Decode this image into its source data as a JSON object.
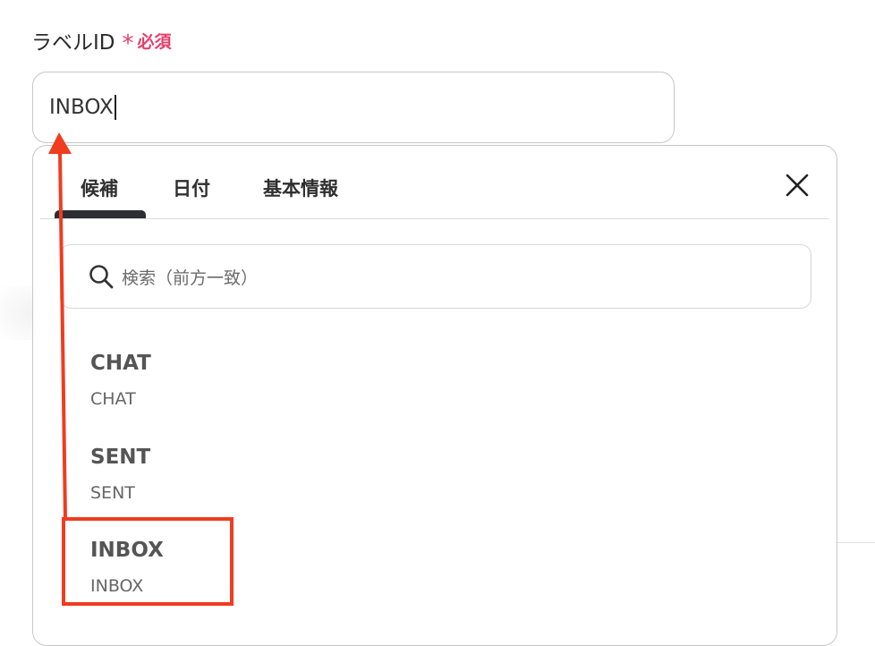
{
  "field": {
    "label": "ラベルID",
    "required_mark": "*",
    "required_text": "必須",
    "value": "INBOX"
  },
  "tabs": [
    {
      "label": "候補",
      "active": true
    },
    {
      "label": "日付",
      "active": false
    },
    {
      "label": "基本情報",
      "active": false
    }
  ],
  "search": {
    "placeholder": "検索（前方一致）"
  },
  "options": [
    {
      "title": "CHAT",
      "subtitle": "CHAT"
    },
    {
      "title": "SENT",
      "subtitle": "SENT"
    },
    {
      "title": "INBOX",
      "subtitle": "INBOX",
      "highlighted": true
    }
  ],
  "icons": {
    "close": "close-icon",
    "search": "search-icon"
  },
  "colors": {
    "required": "#e53e6a",
    "annotation": "#f03c1f",
    "tab_indicator": "#2b2d33"
  }
}
